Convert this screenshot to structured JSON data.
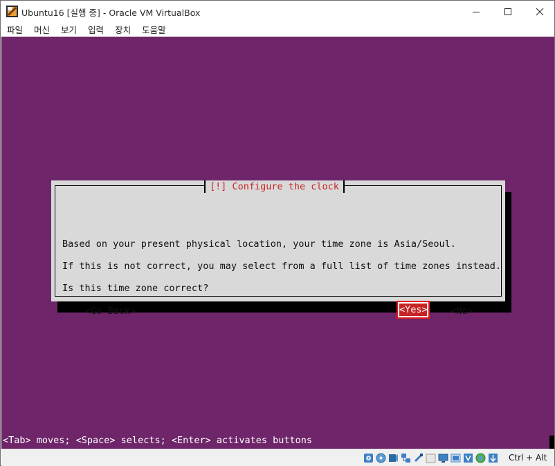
{
  "window": {
    "title": "Ubuntu16 [실행 중] - Oracle VM VirtualBox"
  },
  "menu": {
    "items": [
      "파일",
      "머신",
      "보기",
      "입력",
      "장치",
      "도움말"
    ]
  },
  "dialog": {
    "title": "[!] Configure the clock",
    "lines": [
      "Based on your present physical location, your time zone is Asia/Seoul.",
      "If this is not correct, you may select from a full list of time zones instead.",
      "Is this time zone correct?"
    ],
    "buttons": {
      "back": "<Go Back>",
      "yes": "<Yes>",
      "no": "<No>"
    }
  },
  "help": "<Tab> moves; <Space> selects; <Enter> activates buttons",
  "statusbar": {
    "icons": [
      "hard-disk-icon",
      "optical-drive-icon",
      "audio-icon",
      "network-icon",
      "usb-icon",
      "shared-folder-icon",
      "display-icon",
      "video-capture-icon",
      "virtualization-icon",
      "mouse-integration-icon",
      "keyboard-capture-icon"
    ],
    "host_key": "Ctrl + Alt"
  },
  "colors": {
    "vm_background": "#6e2569",
    "dialog_title": "#c62424",
    "selected_button": "#c62424",
    "highlight_border": "#e11a1a"
  }
}
